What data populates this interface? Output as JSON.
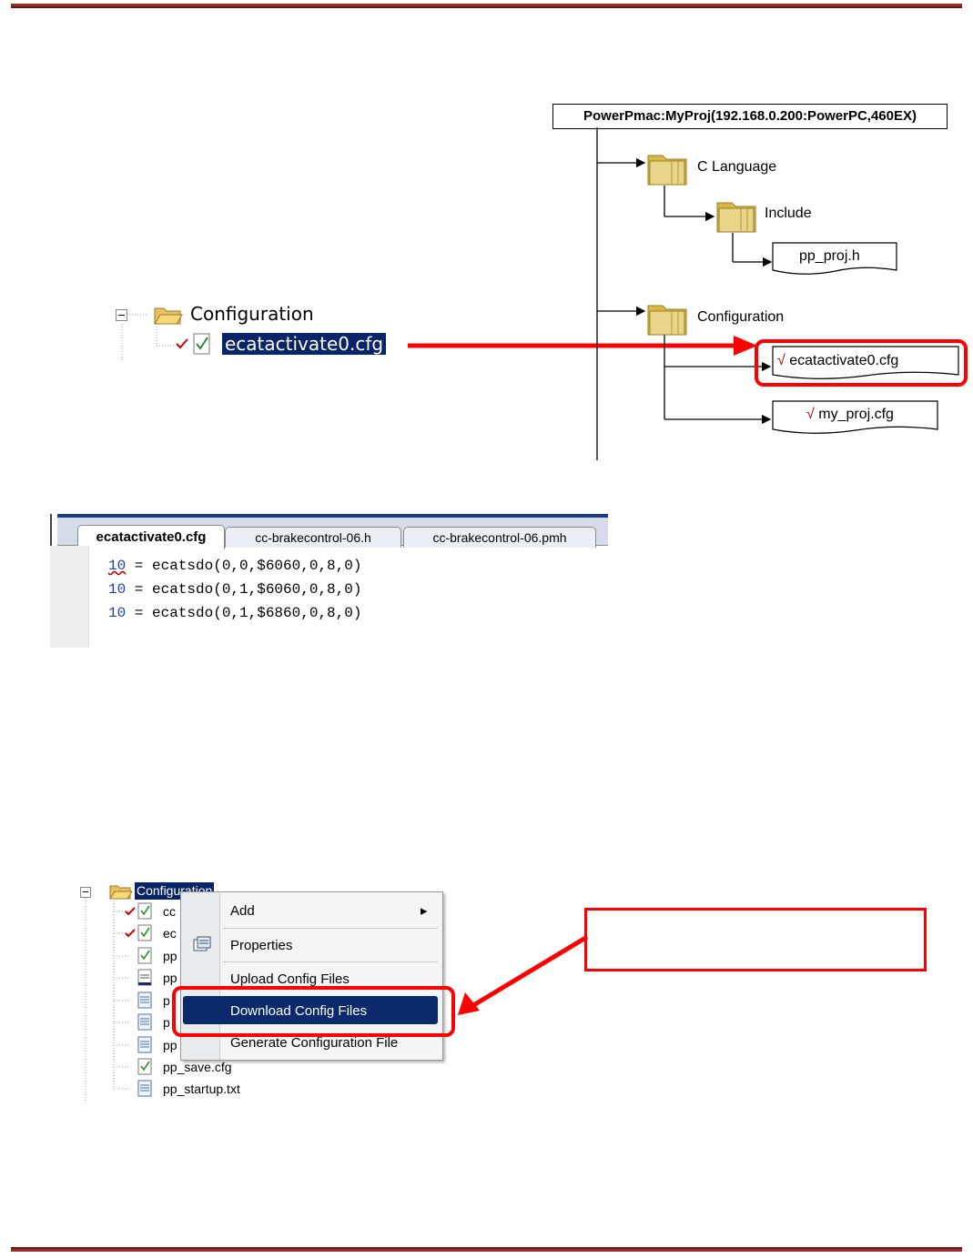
{
  "tree_top": {
    "folder_label": "Configuration",
    "file_label": "ecatactivate0.cfg"
  },
  "diagram": {
    "root": "PowerPmac:MyProj(192.168.0.200:PowerPC,460EX)",
    "folders": [
      "C Language",
      "Include",
      "Configuration"
    ],
    "doc_include": "pp_proj.h",
    "check_mark": "√",
    "doc_cfg1": "ecatactivate0.cfg",
    "doc_cfg2": "my_proj.cfg"
  },
  "editor": {
    "tabs": [
      "ecatactivate0.cfg",
      "cc-brakecontrol-06.h",
      "cc-brakecontrol-06.pmh"
    ],
    "lines": [
      {
        "num": "10",
        "code": " = ecatsdo(0,0,$6060,0,8,0)"
      },
      {
        "num": "10",
        "code": " = ecatsdo(0,1,$6060,0,8,0)"
      },
      {
        "num": "10",
        "code": " = ecatsdo(0,1,$6860,0,8,0)"
      }
    ]
  },
  "tree_bottom": {
    "folder_label": "Configuration",
    "items": [
      "cc",
      "ec",
      "pp",
      "pp",
      "p",
      "p",
      "pp",
      "pp_save.cfg",
      "pp_startup.txt"
    ]
  },
  "context_menu": {
    "items": [
      "Add",
      "Properties",
      "Upload Config Files",
      "Download Config Files",
      "Generate Configuration File"
    ],
    "submenu_arrow": "▸"
  },
  "colors": {
    "accent_red": "#ff0000",
    "selection_blue": "#0a246a",
    "header_rule": "#9b2c2c"
  }
}
